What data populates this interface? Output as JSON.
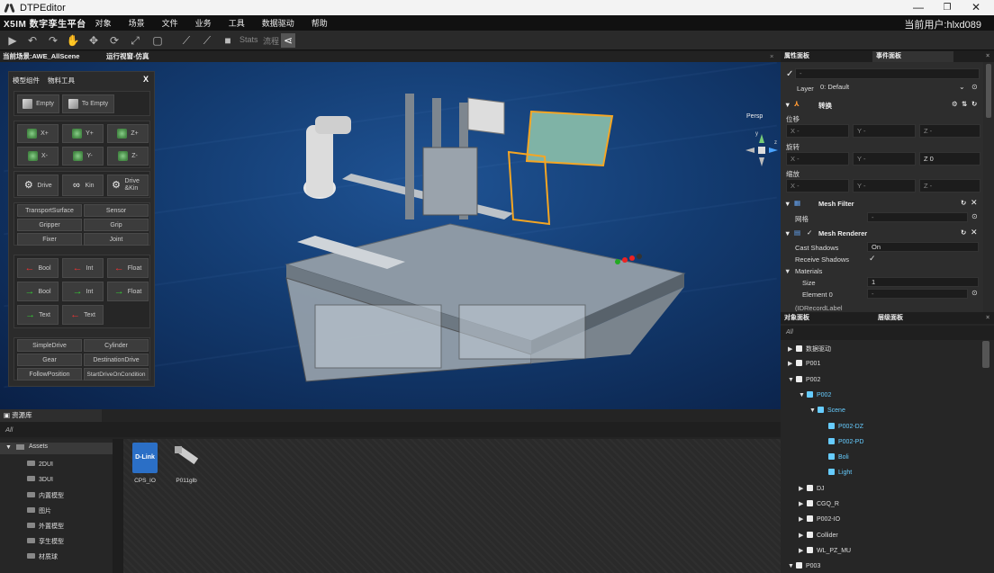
{
  "window": {
    "title": "DTPEditor",
    "minimize": "—",
    "maximize": "❐",
    "close": "✕"
  },
  "menubar": {
    "brand": "X5IM 数字孪生平台",
    "items": [
      "对象",
      "场景",
      "文件",
      "业务",
      "工具",
      "数据驱动",
      "帮助"
    ],
    "current_user": "当前用户:hlxd089"
  },
  "toolbar": {
    "stats_label": "Stats",
    "flow_label": "流程"
  },
  "viewport": {
    "tabs": [
      "当前场景:AWE_AllScene",
      "运行视窗-仿真"
    ],
    "close": "×",
    "projection": "Persp",
    "gizmo": {
      "y": "y",
      "z": "z"
    }
  },
  "component_panel": {
    "tabs": [
      "模型组件",
      "物料工具"
    ],
    "close": "X",
    "empty_buttons": [
      "Empty",
      "To Empty"
    ],
    "axis_buttons": [
      "X+",
      "Y+",
      "Z+",
      "X-",
      "Y-",
      "Z-"
    ],
    "drive_buttons": [
      "Drive",
      "Kin",
      "Drive &Kin"
    ],
    "type_buttons": [
      "TransportSurface",
      "Sensor",
      "Gripper",
      "Grip",
      "Fixer",
      "Joint"
    ],
    "signal_buttons": [
      "Bool",
      "Int",
      "Float",
      "Bool",
      "Int",
      "Float",
      "Text",
      "Text"
    ],
    "behavior_buttons": [
      "SimpleDrive",
      "Cylinder",
      "Gear",
      "DestinationDrive",
      "FollowPosition",
      "StartDriveOnCondition"
    ]
  },
  "property_panel": {
    "tabs": [
      "属性面板",
      "事件面板"
    ],
    "name_value": "-",
    "layer_label": "Layer",
    "layer_value": "0: Default",
    "transform_title": "转换",
    "position_label": "位移",
    "rotation_label": "旋转",
    "scale_label": "缩放",
    "position": [
      "X -",
      "Y -",
      "Z -"
    ],
    "rotation": [
      "X -",
      "Y -",
      "Z 0"
    ],
    "scale": [
      "X -",
      "Y -",
      "Z -"
    ],
    "mesh_filter": {
      "title": "Mesh Filter",
      "mesh_label": "网格",
      "mesh_value": "-"
    },
    "mesh_renderer": {
      "title": "Mesh Renderer",
      "cast_shadows_label": "Cast Shadows",
      "cast_shadows_value": "On",
      "receive_shadows_label": "Receive Shadows",
      "receive_shadows_check": "✓",
      "materials_label": "Materials",
      "size_label": "Size",
      "size_value": "1",
      "element_label": "Element 0",
      "element_value": "-"
    },
    "next_component": "(IDRecordLabel"
  },
  "object_panel": {
    "tabs": [
      "对象面板",
      "层级面板"
    ],
    "search_placeholder": "All",
    "tree": [
      {
        "label": "数据驱动",
        "arrow": "▶"
      },
      {
        "label": "P001",
        "arrow": "▶"
      },
      {
        "label": "P002",
        "arrow": "▼"
      },
      {
        "label": "P002",
        "arrow": "▼"
      },
      {
        "label": "Scene",
        "arrow": "▼"
      },
      {
        "label": "P002-DZ",
        "arrow": ""
      },
      {
        "label": "P002-PD",
        "arrow": ""
      },
      {
        "label": "Boli",
        "arrow": ""
      },
      {
        "label": "Light",
        "arrow": ""
      },
      {
        "label": "DJ",
        "arrow": "▶"
      },
      {
        "label": "CGQ_R",
        "arrow": "▶"
      },
      {
        "label": "P002-IO",
        "arrow": "▶"
      },
      {
        "label": "Collider",
        "arrow": "▶"
      },
      {
        "label": "WL_PZ_MU",
        "arrow": "▶"
      },
      {
        "label": "P003",
        "arrow": "▼"
      }
    ]
  },
  "asset_panel": {
    "title": "资源库",
    "search_placeholder": "All",
    "root": "Assets",
    "folders": [
      "2DUI",
      "3DUI",
      "内置模型",
      "图片",
      "外置模型",
      "孪生模型",
      "材质球"
    ],
    "files": [
      {
        "name": "CPS_IO",
        "icon_text": "D-Link"
      },
      {
        "name": "P011glb",
        "icon_text": ""
      }
    ]
  },
  "colors": {
    "accent": "#4aa3ff",
    "selection": "#f5a623",
    "status_dot": "#f39200"
  }
}
